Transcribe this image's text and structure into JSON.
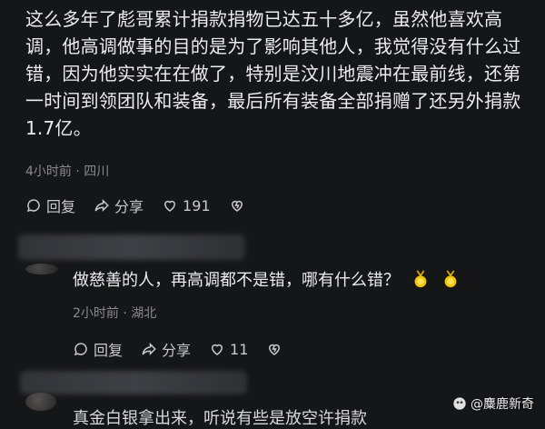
{
  "comment1": {
    "lines": [
      "这么多年了彪哥累计捐款捐物已达五十多亿，虽然他喜欢高",
      "调，他高调做事的目的是为了影响其他人，我觉得没有什么过",
      "错，因为他实实在在做了，特别是汶川地震冲在最前线，还第",
      "一时间到领团队和装备，最后所有装备全部捐赠了还另外捐款",
      "1.7亿。"
    ],
    "meta": "4小时前 · 四川",
    "reply_label": "回复",
    "share_label": "分享",
    "likes": "191"
  },
  "comment2": {
    "text": "做慈善的人，再高调都不是错，哪有什么错？",
    "meta": "2小时前 · 湖北",
    "reply_label": "回复",
    "share_label": "分享",
    "likes": "11"
  },
  "comment3": {
    "partial_text": "真金白银拿出来，听说有些是放空许捐款"
  },
  "watermark": {
    "text": "@麋鹿新奇"
  },
  "colors": {
    "background": "#151618",
    "text": "#ececec",
    "meta": "#8a8a8e"
  },
  "icons": [
    "reply-icon",
    "share-icon",
    "like-icon",
    "dislike-icon",
    "medal-icon",
    "watermark-logo-icon"
  ]
}
